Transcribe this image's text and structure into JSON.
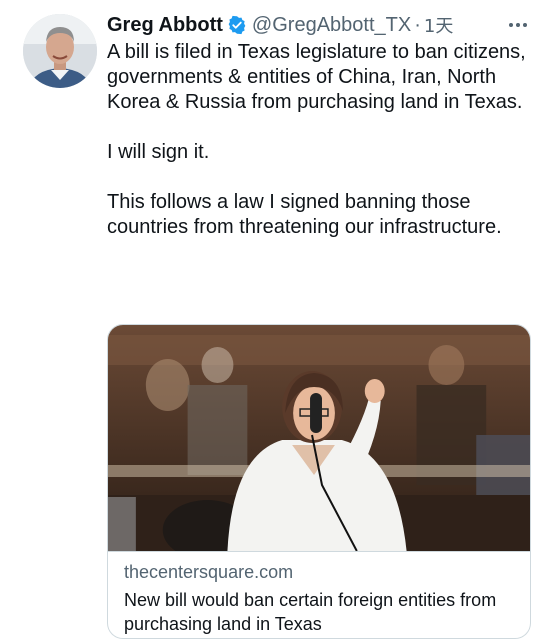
{
  "tweet": {
    "author_name": "Greg Abbott",
    "handle": "@GregAbbott_TX",
    "separator": "·",
    "time": "1天",
    "paragraphs": [
      "A bill is filed in Texas legislature to ban citizens, governments & entities of China, Iran, North Korea & Russia from purchasing land in Texas.",
      "I will sign it.",
      "This follows a law I signed banning those countries from threatening our infrastructure."
    ]
  },
  "icons": {
    "verified": "verified-badge-icon",
    "more": "more-options-icon"
  },
  "colors": {
    "text": "#0f1419",
    "secondary": "#536471",
    "verified_blue": "#1d9bf0",
    "border": "#cfd9de"
  },
  "link_card": {
    "domain": "thecentersquare.com",
    "title": "New bill would ban certain foreign entities from purchasing land in Texas"
  }
}
